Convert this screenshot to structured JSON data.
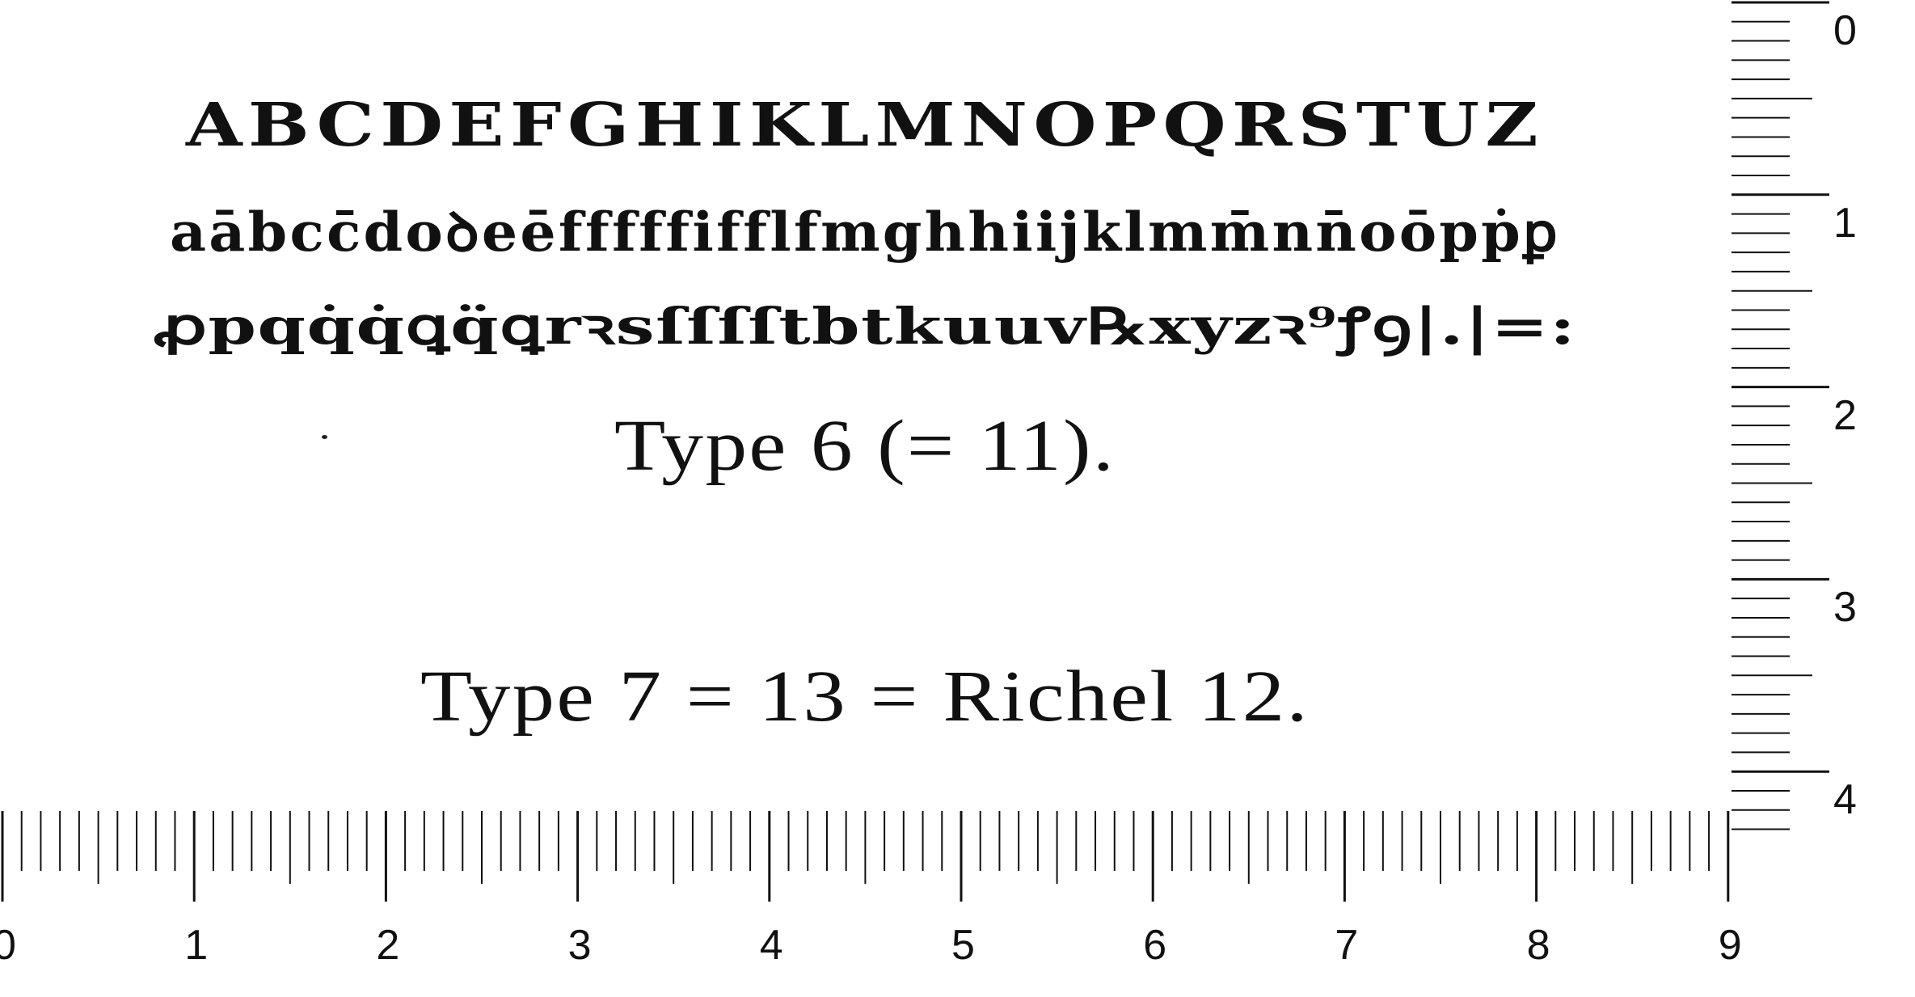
{
  "specimen": {
    "uppercase_row": "ABCDEFGHIKLMNOPQRSTUZ",
    "lowercase_row_1": "aābcc̄doꝺeēfffffifflfmghhiijklmm̄nn̄oōpṗꝑ",
    "lowercase_row_2": "ꝓpqq̇q̇ꝗq̈ꝗrꝛsſſſſtbtkuuv℞xyzꝛ⁹ꝭꝯ|.|=:",
    "caption_type6": "Type 6 (= 11).",
    "caption_type7": "Type 7 = 13 = Richel 12."
  },
  "ruler": {
    "horizontal_labels": [
      "0",
      "1",
      "2",
      "3",
      "4",
      "5",
      "6",
      "7",
      "8",
      "9"
    ],
    "vertical_labels": [
      "0",
      "1",
      "2",
      "3",
      "4"
    ],
    "color": "#111111"
  }
}
